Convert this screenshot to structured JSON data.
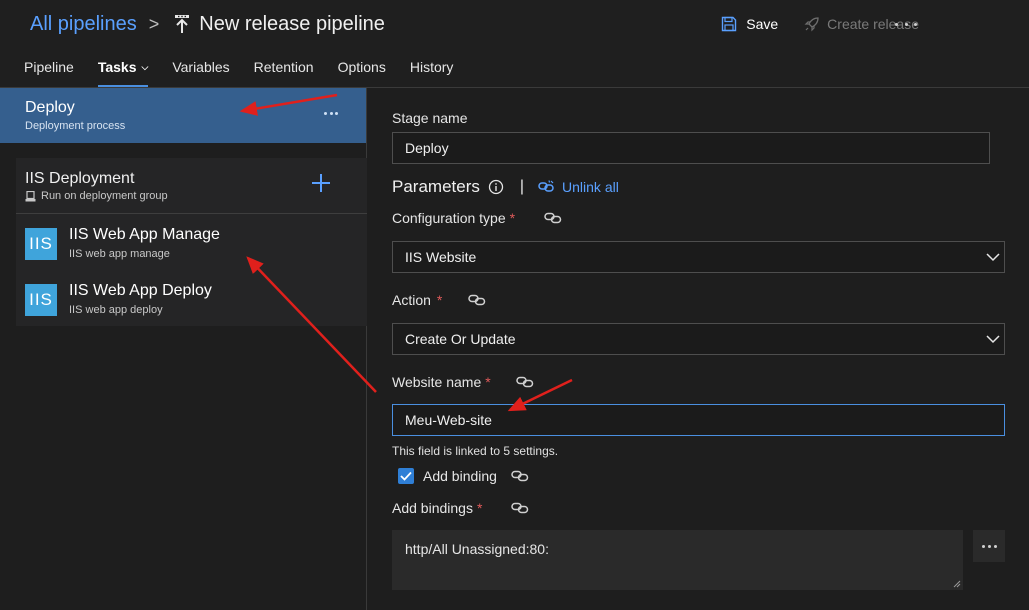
{
  "header": {
    "breadcrumb_root": "All pipelines",
    "breadcrumb_sep": ">",
    "page_title": "New release pipeline",
    "save_label": "Save",
    "create_release_label": "Create release"
  },
  "tabs": [
    {
      "label": "Pipeline"
    },
    {
      "label": "Tasks"
    },
    {
      "label": "Variables"
    },
    {
      "label": "Retention"
    },
    {
      "label": "Options"
    },
    {
      "label": "History"
    }
  ],
  "active_tab": "Tasks",
  "left": {
    "stage": {
      "title": "Deploy",
      "subtitle": "Deployment process"
    },
    "phase": {
      "title": "IIS Deployment",
      "subtitle": "Run on deployment group"
    },
    "tasks": [
      {
        "icon_text": "IIS",
        "title": "IIS Web App Manage",
        "subtitle": "IIS web app manage"
      },
      {
        "icon_text": "IIS",
        "title": "IIS Web App Deploy",
        "subtitle": "IIS web app deploy"
      }
    ]
  },
  "right": {
    "stage_name_label": "Stage name",
    "stage_name_value": "Deploy",
    "parameters_title": "Parameters",
    "separator": "|",
    "unlink_all_label": "Unlink all",
    "config_type_label": "Configuration type",
    "config_type_value": "IIS Website",
    "action_label": "Action",
    "action_value": "Create Or Update",
    "website_name_label": "Website name",
    "website_name_value": "Meu-Web-site",
    "linked_helper": "This field is linked to 5 settings.",
    "add_binding_label": "Add binding",
    "add_binding_checked": true,
    "add_bindings_label": "Add bindings",
    "add_bindings_value": "http/All Unassigned:80:",
    "required_mark": "*"
  },
  "colors": {
    "accent": "#4a8fe0",
    "link": "#5aa0ff",
    "selected_stage": "#355f8e",
    "task_icon": "#3fa4db",
    "required": "#e05a5a",
    "annotation_arrow": "#e0201c"
  },
  "icons": [
    "pipeline-icon",
    "save-icon",
    "rocket-icon",
    "more-icon",
    "plus-icon",
    "agent-icon",
    "iis-icon",
    "info-icon",
    "unlink-icon",
    "link-icon",
    "chevron-down-icon",
    "check-icon"
  ]
}
